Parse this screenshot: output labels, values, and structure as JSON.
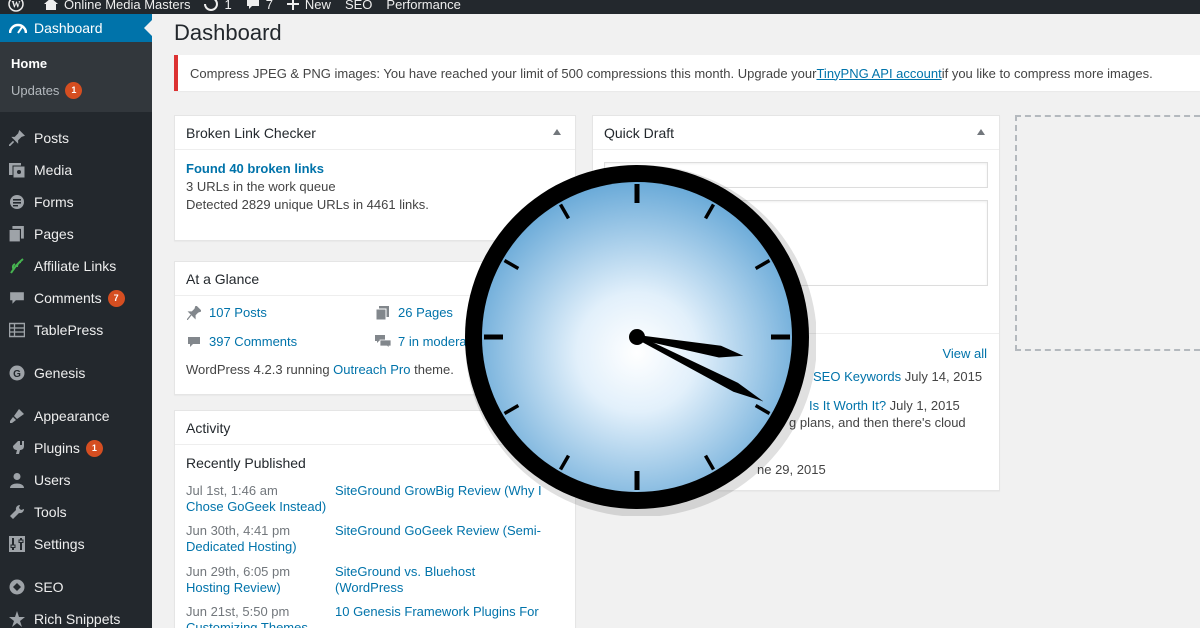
{
  "admin_bar": {
    "site_name": "Online Media Masters",
    "updates_count": "1",
    "comments_count": "7",
    "new_label": "New",
    "seo_label": "SEO",
    "performance_label": "Performance"
  },
  "sidebar": {
    "current": "Dashboard",
    "submenu": {
      "home": "Home",
      "updates": "Updates",
      "updates_badge": "1"
    },
    "items": [
      {
        "label": "Posts",
        "icon": "pin-icon"
      },
      {
        "label": "Media",
        "icon": "media-icon"
      },
      {
        "label": "Forms",
        "icon": "forms-icon"
      },
      {
        "label": "Pages",
        "icon": "pages-icon"
      },
      {
        "label": "Affiliate Links",
        "icon": "affiliate-icon"
      },
      {
        "label": "Comments",
        "icon": "comments-icon",
        "badge": "7"
      },
      {
        "label": "TablePress",
        "icon": "table-icon"
      },
      {
        "label": "Genesis",
        "icon": "genesis-icon"
      },
      {
        "label": "Appearance",
        "icon": "appearance-icon"
      },
      {
        "label": "Plugins",
        "icon": "plugins-icon",
        "badge": "1"
      },
      {
        "label": "Users",
        "icon": "users-icon"
      },
      {
        "label": "Tools",
        "icon": "tools-icon"
      },
      {
        "label": "Settings",
        "icon": "settings-icon"
      },
      {
        "label": "SEO",
        "icon": "seo-icon"
      },
      {
        "label": "Rich Snippets",
        "icon": "star-icon"
      }
    ]
  },
  "main": {
    "title": "Dashboard",
    "notice": {
      "before": "Compress JPEG & PNG images: You have reached your limit of 500 compressions this month. Upgrade your ",
      "link": "TinyPNG API account",
      "after": " if you like to compress more images."
    },
    "broken_link_checker": {
      "title": "Broken Link Checker",
      "found": "Found 40 broken links",
      "queue": "3 URLs in the work queue",
      "detected": "Detected 2829 unique URLs in 4461 links."
    },
    "at_a_glance": {
      "title": "At a Glance",
      "posts": "107 Posts",
      "pages": "26 Pages",
      "comments": "397 Comments",
      "moderation": "7 in modera",
      "version_before": "WordPress 4.2.3 running ",
      "theme_link": "Outreach Pro",
      "version_after": " theme."
    },
    "activity": {
      "title": "Activity",
      "subtitle": "Recently Published",
      "rows": [
        {
          "date": "Jul 1st, 1:46 am",
          "date_link": "Chose GoGeek Instead)",
          "title": "SiteGround GrowBig Review (Why I"
        },
        {
          "date": "Jun 30th, 4:41 pm",
          "date_link": "Dedicated Hosting)",
          "title": "SiteGround GoGeek Review (Semi-"
        },
        {
          "date": "Jun 29th, 6:05 pm",
          "date_link": "Hosting Review)",
          "title": "SiteGround vs. Bluehost (WordPress"
        },
        {
          "date": "Jun 21st, 5:50 pm",
          "date_link": "Customizing Themes",
          "title": "10 Genesis Framework Plugins For"
        }
      ]
    },
    "quick_draft": {
      "title": "Quick Draft",
      "view_all": "View all",
      "line1_link": "SEO Keywords",
      "line1_date": " July 14, 2015",
      "line2_link": "Is It Worth It?",
      "line2_date": " July 1, 2015",
      "line3": "g plans, and then there's cloud",
      "line4": "ne 29, 2015"
    }
  },
  "clock": {
    "hour": 3,
    "minute": 20,
    "colors": {
      "rim": "#000000",
      "face_center": "#ffffff",
      "face_edge": "#6aaad8"
    }
  },
  "colors": {
    "admin_dark": "#23282d",
    "accent_blue": "#0073aa",
    "notice_red": "#dc3232",
    "badge_orange": "#d54e21"
  }
}
